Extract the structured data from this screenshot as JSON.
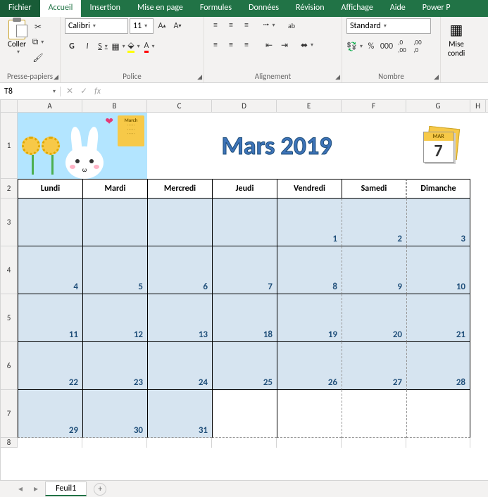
{
  "menu": {
    "file": "Fichier",
    "tabs": [
      "Accueil",
      "Insertion",
      "Mise en page",
      "Formules",
      "Données",
      "Révision",
      "Affichage",
      "Aide",
      "Power P"
    ],
    "active_index": 0
  },
  "ribbon": {
    "clipboard": {
      "paste": "Coller",
      "label": "Presse-papiers"
    },
    "font": {
      "name": "Calibri",
      "size": "11",
      "bold": "G",
      "italic": "I",
      "underline": "S",
      "label": "Police"
    },
    "alignment": {
      "wrap": "ab",
      "merge": "⬌",
      "label": "Alignement"
    },
    "number": {
      "format": "Standard",
      "label": "Nombre"
    },
    "styles": {
      "cond": "Mise",
      "cond2": "condi"
    }
  },
  "formula_bar": {
    "name_box": "T8",
    "cancel": "✕",
    "enter": "✓",
    "fx": "fx",
    "value": ""
  },
  "grid": {
    "columns": [
      "A",
      "B",
      "C",
      "D",
      "E",
      "F",
      "G",
      "H"
    ],
    "rows": [
      "1",
      "2",
      "3",
      "4",
      "5",
      "6",
      "7",
      "8"
    ]
  },
  "calendar": {
    "title": "Mars 2019",
    "mini_month": "March",
    "desk_month": "MAR",
    "desk_day": "7",
    "day_headers": [
      "Lundi",
      "Mardi",
      "Mercredi",
      "Jeudi",
      "Vendredi",
      "Samedi",
      "Dimanche"
    ],
    "weeks": [
      [
        "",
        "",
        "",
        "",
        "1",
        "2",
        "3"
      ],
      [
        "4",
        "5",
        "6",
        "7",
        "8",
        "9",
        "10"
      ],
      [
        "11",
        "12",
        "13",
        "18",
        "19",
        "20",
        "21"
      ],
      [
        "22",
        "23",
        "24",
        "25",
        "26",
        "27",
        "28"
      ],
      [
        "29",
        "30",
        "31",
        "",
        "",
        "",
        ""
      ]
    ]
  },
  "sheet_tabs": {
    "active": "Feuil1"
  }
}
